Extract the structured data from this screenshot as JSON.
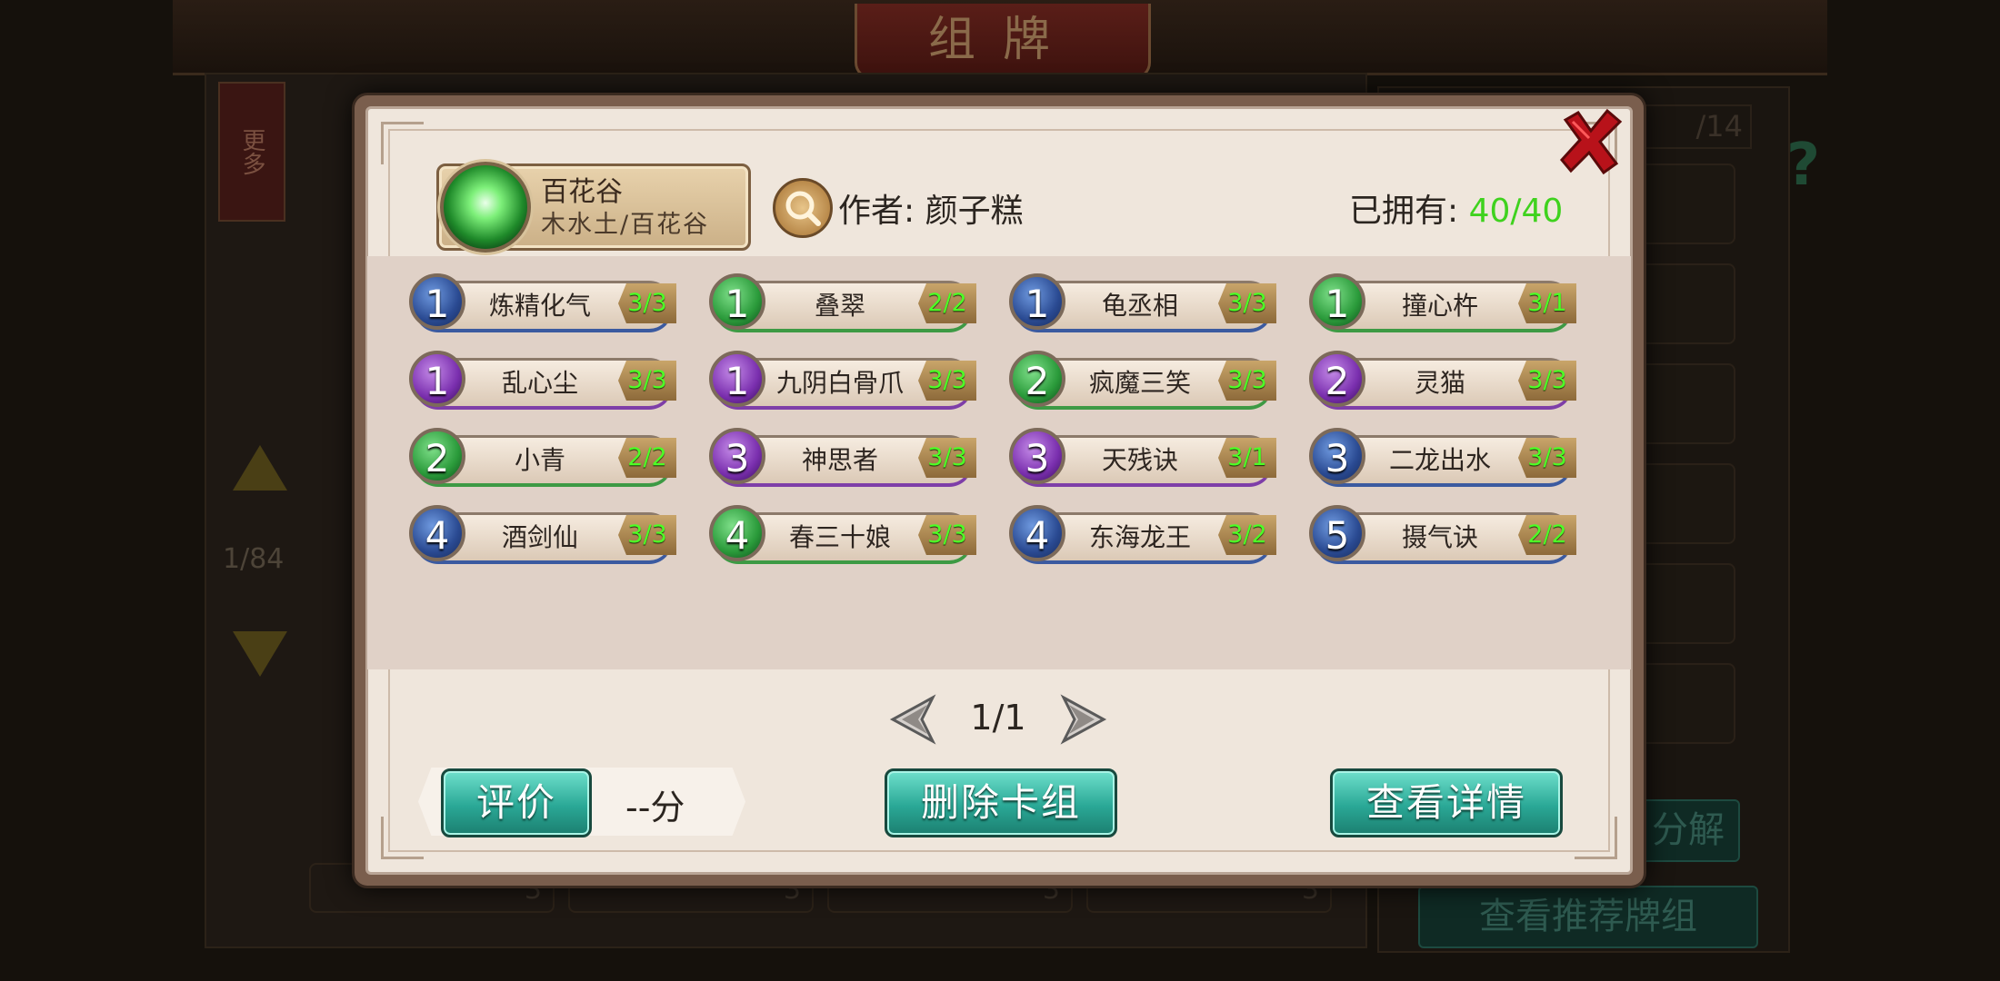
{
  "background": {
    "title": "组牌",
    "more_label": "更多",
    "page_left": "1/84",
    "page_right": "/14",
    "bottom_btn_1": "分解",
    "bottom_btn_2": "查看推荐牌组",
    "card_counts": [
      "3",
      "3",
      "3",
      "3"
    ]
  },
  "deck": {
    "name": "百花谷",
    "subtitle": "木水土/百花谷",
    "author": "作者: 颜子糕",
    "owned_label": "已拥有: ",
    "owned_value": "40/40"
  },
  "cards": [
    {
      "cost": "1",
      "name": "炼精化气",
      "count": "3/3",
      "color": "blue"
    },
    {
      "cost": "1",
      "name": "叠翠",
      "count": "2/2",
      "color": "green"
    },
    {
      "cost": "1",
      "name": "龟丞相",
      "count": "3/3",
      "color": "blue"
    },
    {
      "cost": "1",
      "name": "撞心杵",
      "count": "3/1",
      "color": "green"
    },
    {
      "cost": "1",
      "name": "乱心尘",
      "count": "3/3",
      "color": "purple"
    },
    {
      "cost": "1",
      "name": "九阴白骨爪",
      "count": "3/3",
      "color": "purple"
    },
    {
      "cost": "2",
      "name": "疯魔三笑",
      "count": "3/3",
      "color": "green"
    },
    {
      "cost": "2",
      "name": "灵猫",
      "count": "3/3",
      "color": "purple"
    },
    {
      "cost": "2",
      "name": "小青",
      "count": "2/2",
      "color": "green"
    },
    {
      "cost": "3",
      "name": "神思者",
      "count": "3/3",
      "color": "purple"
    },
    {
      "cost": "3",
      "name": "天残诀",
      "count": "3/1",
      "color": "purple"
    },
    {
      "cost": "3",
      "name": "二龙出水",
      "count": "3/3",
      "color": "blue"
    },
    {
      "cost": "4",
      "name": "酒剑仙",
      "count": "3/3",
      "color": "blue"
    },
    {
      "cost": "4",
      "name": "春三十娘",
      "count": "3/3",
      "color": "green"
    },
    {
      "cost": "4",
      "name": "东海龙王",
      "count": "3/2",
      "color": "blue"
    },
    {
      "cost": "5",
      "name": "摄气诀",
      "count": "2/2",
      "color": "blue"
    }
  ],
  "pager": {
    "text": "1/1"
  },
  "actions": {
    "rate_label": "评价",
    "score_text": "--分",
    "delete_label": "删除卡组",
    "detail_label": "查看详情"
  },
  "colors": {
    "owned_green": "#3fd21e",
    "count_green": "#4dff26",
    "button_teal": "#2aa896",
    "close_red": "#b8121a"
  },
  "icons": {
    "close": "close-x-icon",
    "search": "magnifier-icon",
    "prev": "triangle-left-icon",
    "next": "triangle-right-icon",
    "help": "question-mark-icon"
  }
}
